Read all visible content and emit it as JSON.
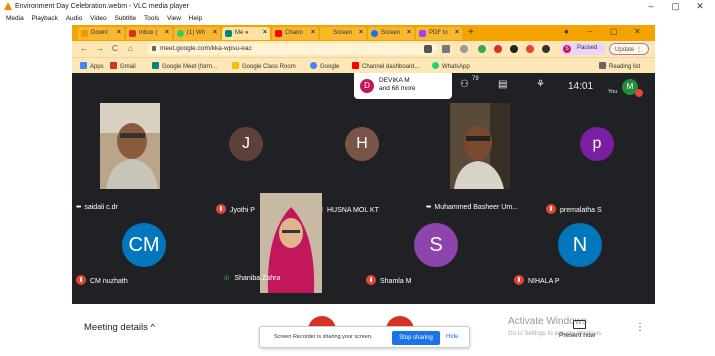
{
  "vlc": {
    "title": "Environment Day Celebration.webm - VLC media player",
    "menu": [
      "Media",
      "Playback",
      "Audio",
      "Video",
      "Subtitle",
      "Tools",
      "View",
      "Help"
    ],
    "controls": [
      "–",
      "▢",
      "✕"
    ]
  },
  "browser": {
    "tabs": [
      {
        "label": "Downl",
        "color": "#f29900"
      },
      {
        "label": "Inbox (",
        "color": "#d93025"
      },
      {
        "label": "(1) Wh",
        "color": "#25d366"
      },
      {
        "label": "Me",
        "color": "#00897b"
      },
      {
        "label": "Chann",
        "color": "#ff0000"
      },
      {
        "label": "Screen",
        "color": "#fbbc04"
      },
      {
        "label": "Screen",
        "color": "#1a73e8"
      },
      {
        "label": "PDF to",
        "color": "#a142f4"
      }
    ],
    "new_tab": "+",
    "url": "meet.google.com/kka-wpsu-eac",
    "profile_status": "Paused",
    "profile_initial": "S",
    "update_label": "Update",
    "bookmarks": [
      {
        "label": "Apps",
        "color": "#4285f4"
      },
      {
        "label": "Gmail",
        "color": "#d93025"
      },
      {
        "label": "Google Meet (form...",
        "color": "#00897b"
      },
      {
        "label": "Google Class Room",
        "color": "#fbbc04"
      },
      {
        "label": "Google",
        "color": "#4285f4"
      },
      {
        "label": "Channel dashboard...",
        "color": "#ff0000"
      },
      {
        "label": "WhatsApp",
        "color": "#25d366"
      }
    ],
    "reading_list": "Reading list"
  },
  "meet": {
    "presenter_name": "DEVIKA M",
    "presenter_sub": "and 68 more",
    "presenter_initial": "D",
    "participant_count": "79",
    "time": "14:01",
    "you_label": "You",
    "you_initial": "M",
    "participants": [
      {
        "name": "saidali c.dr",
        "initial": "",
        "bg": ""
      },
      {
        "name": "Jyothi P",
        "initial": "J",
        "bg": "#5d4037"
      },
      {
        "name": "HUSNA MOL KT",
        "initial": "H",
        "bg": "#795548"
      },
      {
        "name": "Muhammed Basheer Um...",
        "initial": "",
        "bg": ""
      },
      {
        "name": "premalatha S",
        "initial": "p",
        "bg": "#7b1fa2"
      },
      {
        "name": "CM nuzhath",
        "initial": "CM",
        "bg": "#0277bd"
      },
      {
        "name": "Shaniba Zahra",
        "initial": "",
        "bg": ""
      },
      {
        "name": "Shamla M",
        "initial": "S",
        "bg": "#8e44ad"
      },
      {
        "name": "NIHALA P",
        "initial": "N",
        "bg": "#0277bd"
      }
    ],
    "meeting_details": "Meeting details",
    "share_text": "Screen Recorder is sharing your screen.",
    "stop_sharing": "Stop sharing",
    "hide": "Hide",
    "activate_title": "Activate Windows",
    "activate_sub": "Go to Settings to activate Windows.",
    "present_now": "Present now"
  }
}
